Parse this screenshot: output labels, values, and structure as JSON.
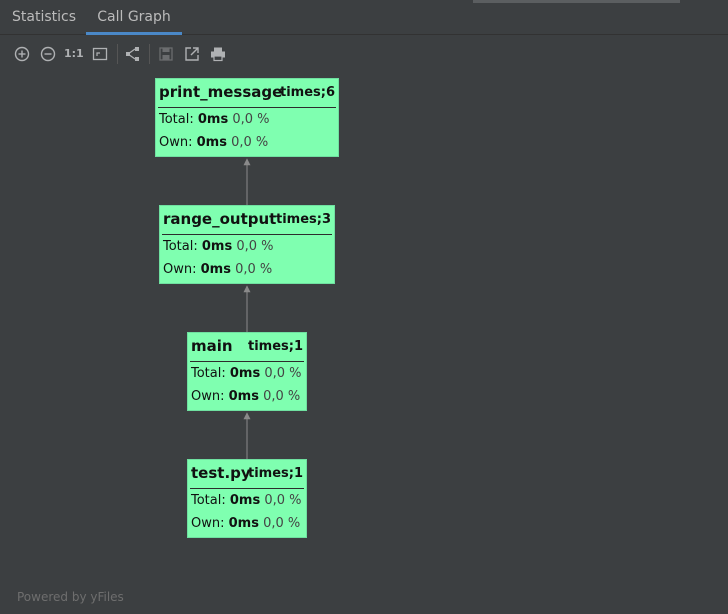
{
  "tabs": [
    {
      "label": "Statistics",
      "active": false
    },
    {
      "label": "Call Graph",
      "active": true
    }
  ],
  "toolbar": {
    "icons": [
      "zoom-in-icon",
      "zoom-out-icon",
      "actual-size-icon",
      "fit-content-icon",
      "layout-icon",
      "save-icon",
      "export-icon",
      "print-icon"
    ],
    "actual_size_label": "1:1"
  },
  "graph": {
    "labels": {
      "total": "Total:",
      "own": "Own:"
    },
    "nodes": [
      {
        "name": "print_message",
        "times": "times;6",
        "total_ms": "0ms",
        "total_pct": "0,0 %",
        "own_ms": "0ms",
        "own_pct": "0,0 %"
      },
      {
        "name": "range_output",
        "times": "times;3",
        "total_ms": "0ms",
        "total_pct": "0,0 %",
        "own_ms": "0ms",
        "own_pct": "0,0 %"
      },
      {
        "name": "main",
        "times": "times;1",
        "total_ms": "0ms",
        "total_pct": "0,0 %",
        "own_ms": "0ms",
        "own_pct": "0,0 %"
      },
      {
        "name": "test.py",
        "times": "times;1",
        "total_ms": "0ms",
        "total_pct": "0,0 %",
        "own_ms": "0ms",
        "own_pct": "0,0 %"
      }
    ],
    "node_color": "#7fffb0",
    "edge_color": "#8a8a8a"
  },
  "footer": {
    "text": "Powered by yFiles"
  }
}
